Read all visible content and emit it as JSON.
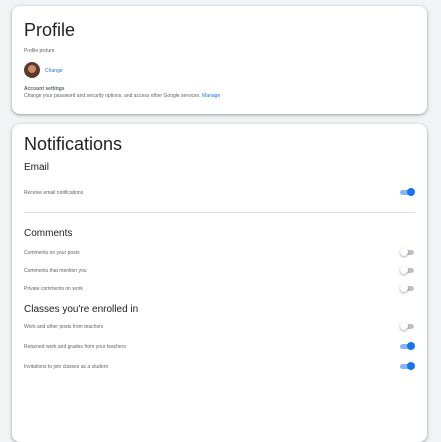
{
  "profile": {
    "title": "Profile",
    "picture_label": "Profile picture",
    "change_label": "Change",
    "account_settings_label": "Account settings",
    "account_settings_desc": "Change your password and security options, and access other Google services.",
    "manage_label": "Manage"
  },
  "notifications": {
    "title": "Notifications",
    "email": {
      "title": "Email",
      "receive": {
        "label": "Receive email notifications",
        "on": true
      }
    },
    "comments": {
      "title": "Comments",
      "items": [
        {
          "label": "Comments on your posts",
          "on": false
        },
        {
          "label": "Comments that mention you",
          "on": false
        },
        {
          "label": "Private comments on work",
          "on": false
        }
      ]
    },
    "classes": {
      "title": "Classes you're enrolled in",
      "items": [
        {
          "label": "Work and other posts from teachers",
          "on": false
        },
        {
          "label": "Returned work and grades from your teachers",
          "on": true
        },
        {
          "label": "Invitations to join classes as a student",
          "on": true
        }
      ]
    }
  },
  "colors": {
    "accent": "#1a73e8",
    "toggle_on_track": "#8ab4f8",
    "toggle_off_track": "#bdc1c6",
    "background": "#f1f3f4"
  }
}
